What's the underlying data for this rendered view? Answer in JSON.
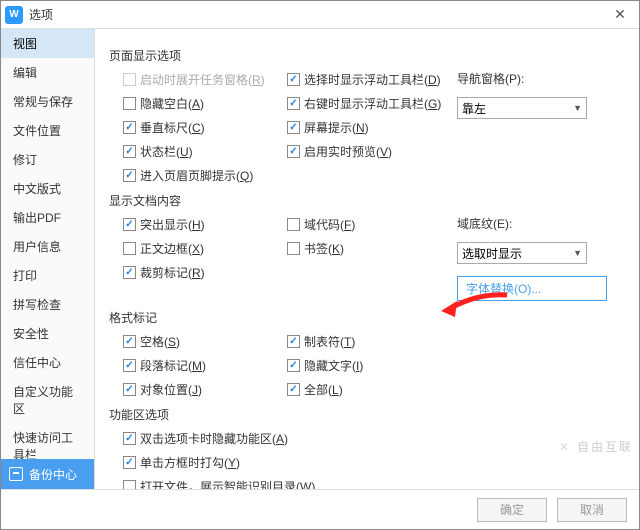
{
  "window": {
    "title": "选项",
    "app_glyph": "W",
    "close": "✕"
  },
  "sidebar": {
    "items": [
      "视图",
      "编辑",
      "常规与保存",
      "文件位置",
      "修订",
      "中文版式",
      "输出PDF",
      "用户信息",
      "打印",
      "拼写检查",
      "安全性",
      "信任中心",
      "自定义功能区",
      "快速访问工具栏"
    ],
    "active_index": 0,
    "backup": "备份中心"
  },
  "sections": {
    "page_display": {
      "title": "页面显示选项",
      "col1": [
        {
          "label": "启动时展开任务窗格(R)",
          "checked": false,
          "disabled": true
        },
        {
          "label": "隐藏空白(A)",
          "checked": false
        },
        {
          "label": "垂直标尺(C)",
          "checked": true
        },
        {
          "label": "状态栏(U)",
          "checked": true
        },
        {
          "label": "进入页眉页脚提示(Q)",
          "checked": true
        }
      ],
      "col2": [
        {
          "label": "选择时显示浮动工具栏(D)",
          "checked": true
        },
        {
          "label": "右键时显示浮动工具栏(G)",
          "checked": true
        },
        {
          "label": "屏幕提示(N)",
          "checked": true
        },
        {
          "label": "启用实时预览(V)",
          "checked": true
        }
      ],
      "nav": {
        "label": "导航窗格(P):",
        "value": "靠左"
      }
    },
    "doc_content": {
      "title": "显示文档内容",
      "col1": [
        {
          "label": "突出显示(H)",
          "checked": true
        },
        {
          "label": "正文边框(X)",
          "checked": false
        },
        {
          "label": "裁剪标记(R)",
          "checked": true
        }
      ],
      "col2": [
        {
          "label": "域代码(F)",
          "checked": false
        },
        {
          "label": "书签(K)",
          "checked": false
        }
      ],
      "shade": {
        "label": "域底纹(E):",
        "value": "选取时显示"
      },
      "font_btn": "字体替换(O)..."
    },
    "format_marks": {
      "title": "格式标记",
      "col1": [
        {
          "label": "空格(S)",
          "checked": true
        },
        {
          "label": "段落标记(M)",
          "checked": true
        },
        {
          "label": "对象位置(J)",
          "checked": true
        }
      ],
      "col2": [
        {
          "label": "制表符(T)",
          "checked": true
        },
        {
          "label": "隐藏文字(I)",
          "checked": true
        },
        {
          "label": "全部(L)",
          "checked": true
        }
      ]
    },
    "ribbon": {
      "title": "功能区选项",
      "items": [
        {
          "label": "双击选项卡时隐藏功能区(A)",
          "checked": true
        },
        {
          "label": "单击方框时打勾(Y)",
          "checked": true
        },
        {
          "label": "打开文件，展示智能识别目录(W)",
          "checked": false
        }
      ]
    }
  },
  "footer": {
    "ok": "确定",
    "cancel": "取消"
  },
  "watermark": "自由互联"
}
